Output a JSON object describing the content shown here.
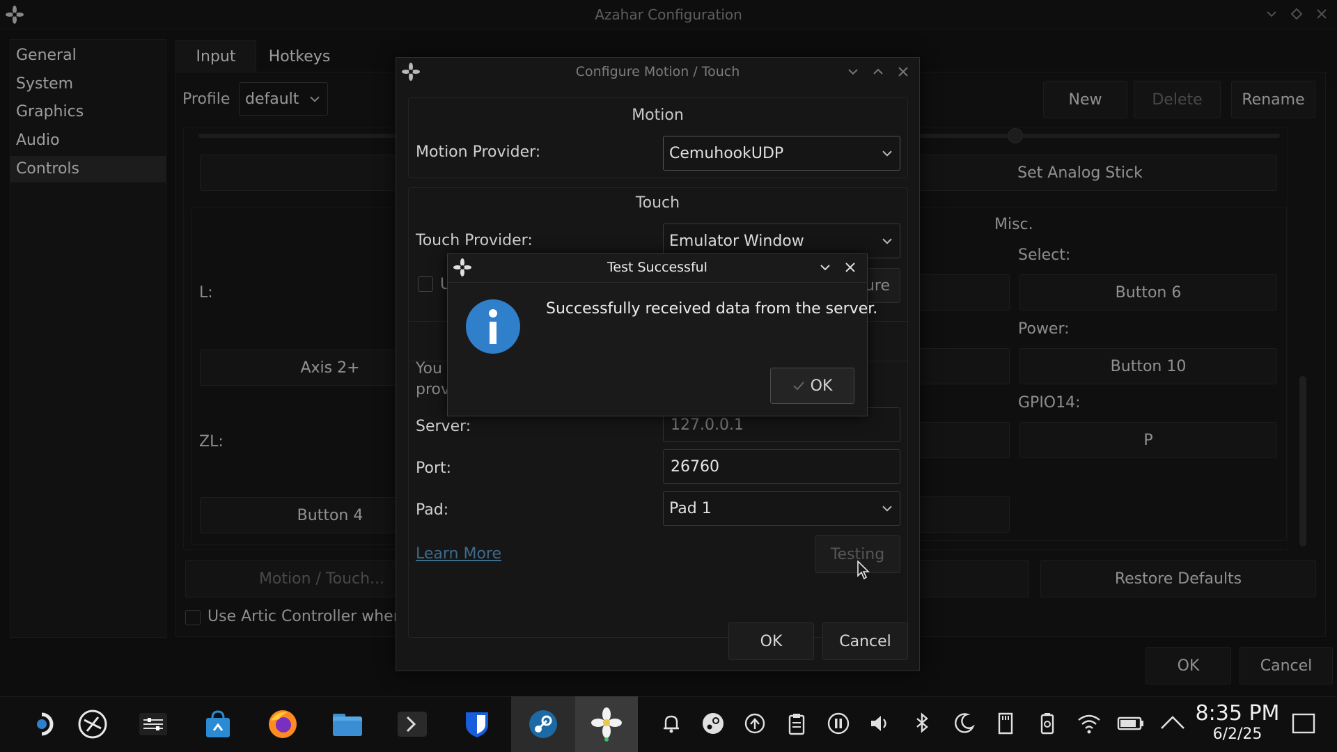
{
  "colors": {
    "accent": "#2f7fcb",
    "background": "#121212",
    "panel": "#1a1a1a"
  },
  "window": {
    "title": "Azahar Configuration",
    "app_icon": "azahar-flower-icon"
  },
  "sidebar": {
    "items": [
      {
        "label": "General"
      },
      {
        "label": "System"
      },
      {
        "label": "Graphics"
      },
      {
        "label": "Audio"
      },
      {
        "label": "Controls",
        "selected": true
      }
    ]
  },
  "tabs": [
    {
      "label": "Input",
      "active": true
    },
    {
      "label": "Hotkeys"
    }
  ],
  "profile": {
    "label": "Profile",
    "value": "default",
    "new": "New",
    "delete": "Delete",
    "rename": "Rename"
  },
  "controls": {
    "l_label": "L:",
    "l_binding": "Axis 2+",
    "zl_label": "ZL:",
    "zl_binding": "Button 4",
    "set_analog_stick": "Set Analog Stick",
    "misc_title": "Misc.",
    "select_label": "Select:",
    "select_binding": "Button 6",
    "power_label": "Power:",
    "power_binding": "Button 10",
    "gpio_label": "GPIO14:",
    "gpio_binding": "P",
    "motion_touch_button": "Motion / Touch...",
    "restore_defaults": "Restore Defaults",
    "artic_checkbox": "Use Artic Controller when",
    "ok": "OK",
    "cancel": "Cancel"
  },
  "motion_dialog": {
    "title": "Configure Motion / Touch",
    "motion_section": "Motion",
    "motion_provider_label": "Motion Provider:",
    "motion_provider_value": "CemuhookUDP",
    "touch_section": "Touch",
    "touch_provider_label": "Touch Provider:",
    "touch_provider_value": "Emulator Window",
    "checkbox_partial": "U",
    "configure_partial": "ure",
    "info_partial_1": "You",
    "info_partial_2": "prov",
    "server_label": "Server:",
    "server_value": "127.0.0.1",
    "port_label": "Port:",
    "port_value": "26760",
    "pad_label": "Pad:",
    "pad_value": "Pad 1",
    "learn_more": "Learn More",
    "testing": "Testing",
    "ok": "OK",
    "cancel": "Cancel"
  },
  "msgbox": {
    "title": "Test Successful",
    "message": "Successfully received data from the server.",
    "ok": "OK"
  },
  "taskbar": {
    "apps": [
      "steam-deck-menu-icon",
      "steamos-icon",
      "mixer-icon",
      "discover-store-icon",
      "firefox-icon",
      "file-manager-icon",
      "terminal-icon",
      "bitwarden-icon",
      "steam-icon",
      "azahar-icon"
    ],
    "tray": [
      "notification-bell-icon",
      "steam-tray-icon",
      "update-icon",
      "clipboard-icon",
      "pause-icon",
      "volume-icon",
      "bluetooth-icon",
      "night-mode-icon",
      "sd-card-icon",
      "battery-manager-icon",
      "wifi-icon",
      "battery-icon",
      "show-hidden-chevron-icon"
    ],
    "time": "8:35 PM",
    "date": "6/2/25"
  }
}
